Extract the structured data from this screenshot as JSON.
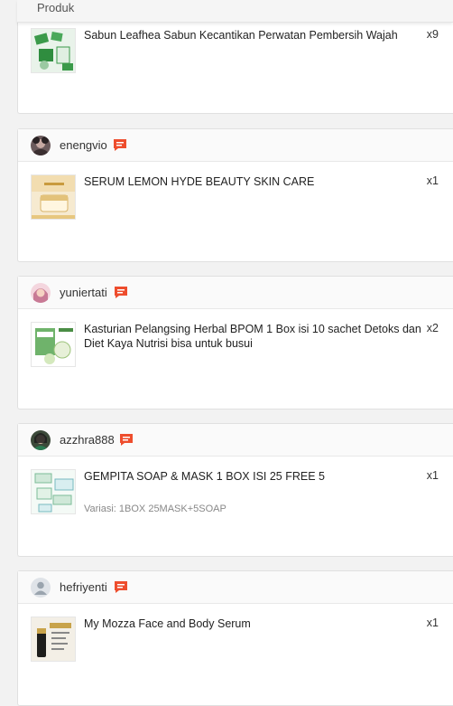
{
  "header": {
    "column_label": "Produk"
  },
  "orders": [
    {
      "username": "",
      "product": "Sabun Leafhea Sabun Kecantikan Perwatan Pembersih Wajah",
      "qty": "x9",
      "variant": ""
    },
    {
      "username": "enengvio",
      "product": "SERUM LEMON HYDE BEAUTY SKIN CARE",
      "qty": "x1",
      "variant": ""
    },
    {
      "username": "yuniertati",
      "product": "Kasturian Pelangsing Herbal BPOM 1 Box isi 10 sachet Detoks dan Diet Kaya Nutrisi bisa untuk busui",
      "qty": "x2",
      "variant": ""
    },
    {
      "username": "azzhra888",
      "product": "GEMPITA SOAP & MASK 1 BOX ISI 25 FREE 5",
      "qty": "x1",
      "variant": "Variasi: 1BOX 25MASK+5SOAP"
    },
    {
      "username": "hefriyenti",
      "product": "My Mozza Face and Body Serum",
      "qty": "x1",
      "variant": ""
    }
  ],
  "icons": {
    "chat": "chat-icon",
    "accent_color": "#ee4d2d"
  }
}
